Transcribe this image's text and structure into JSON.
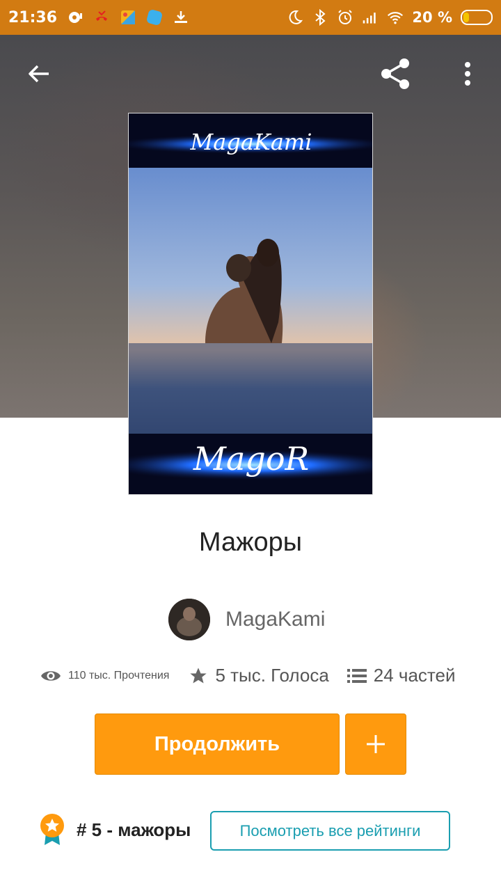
{
  "status_bar": {
    "time": "21:36",
    "battery_percent": "20 %",
    "battery_level": 0.2,
    "left_icons": [
      "notification-icon",
      "missed-call-icon",
      "app-icon",
      "app-icon",
      "download-icon"
    ],
    "right_icons": [
      "moon-icon",
      "bluetooth-icon",
      "alarm-icon",
      "signal-icon",
      "wifi-icon",
      "battery-icon"
    ]
  },
  "toolbar": {
    "back_icon": "arrow-left-icon",
    "share_icon": "share-icon",
    "more_icon": "more-vertical-icon"
  },
  "cover": {
    "top_text": "MagaKami",
    "bottom_text": "MagoR"
  },
  "story": {
    "title": "Мажоры"
  },
  "author": {
    "name": "MagaKami"
  },
  "stats": {
    "reads": "110 тыс. Прочтения",
    "votes": "5 тыс. Голоса",
    "parts": "24 частей"
  },
  "actions": {
    "continue_label": "Продолжить",
    "add_icon": "plus-icon"
  },
  "ranking": {
    "text": "# 5 - мажоры",
    "view_all_label": "Посмотреть все рейтинги"
  },
  "colors": {
    "status_bar": "#d27b12",
    "accent_orange": "#ff9a0e",
    "link_teal": "#1a9eb0"
  }
}
